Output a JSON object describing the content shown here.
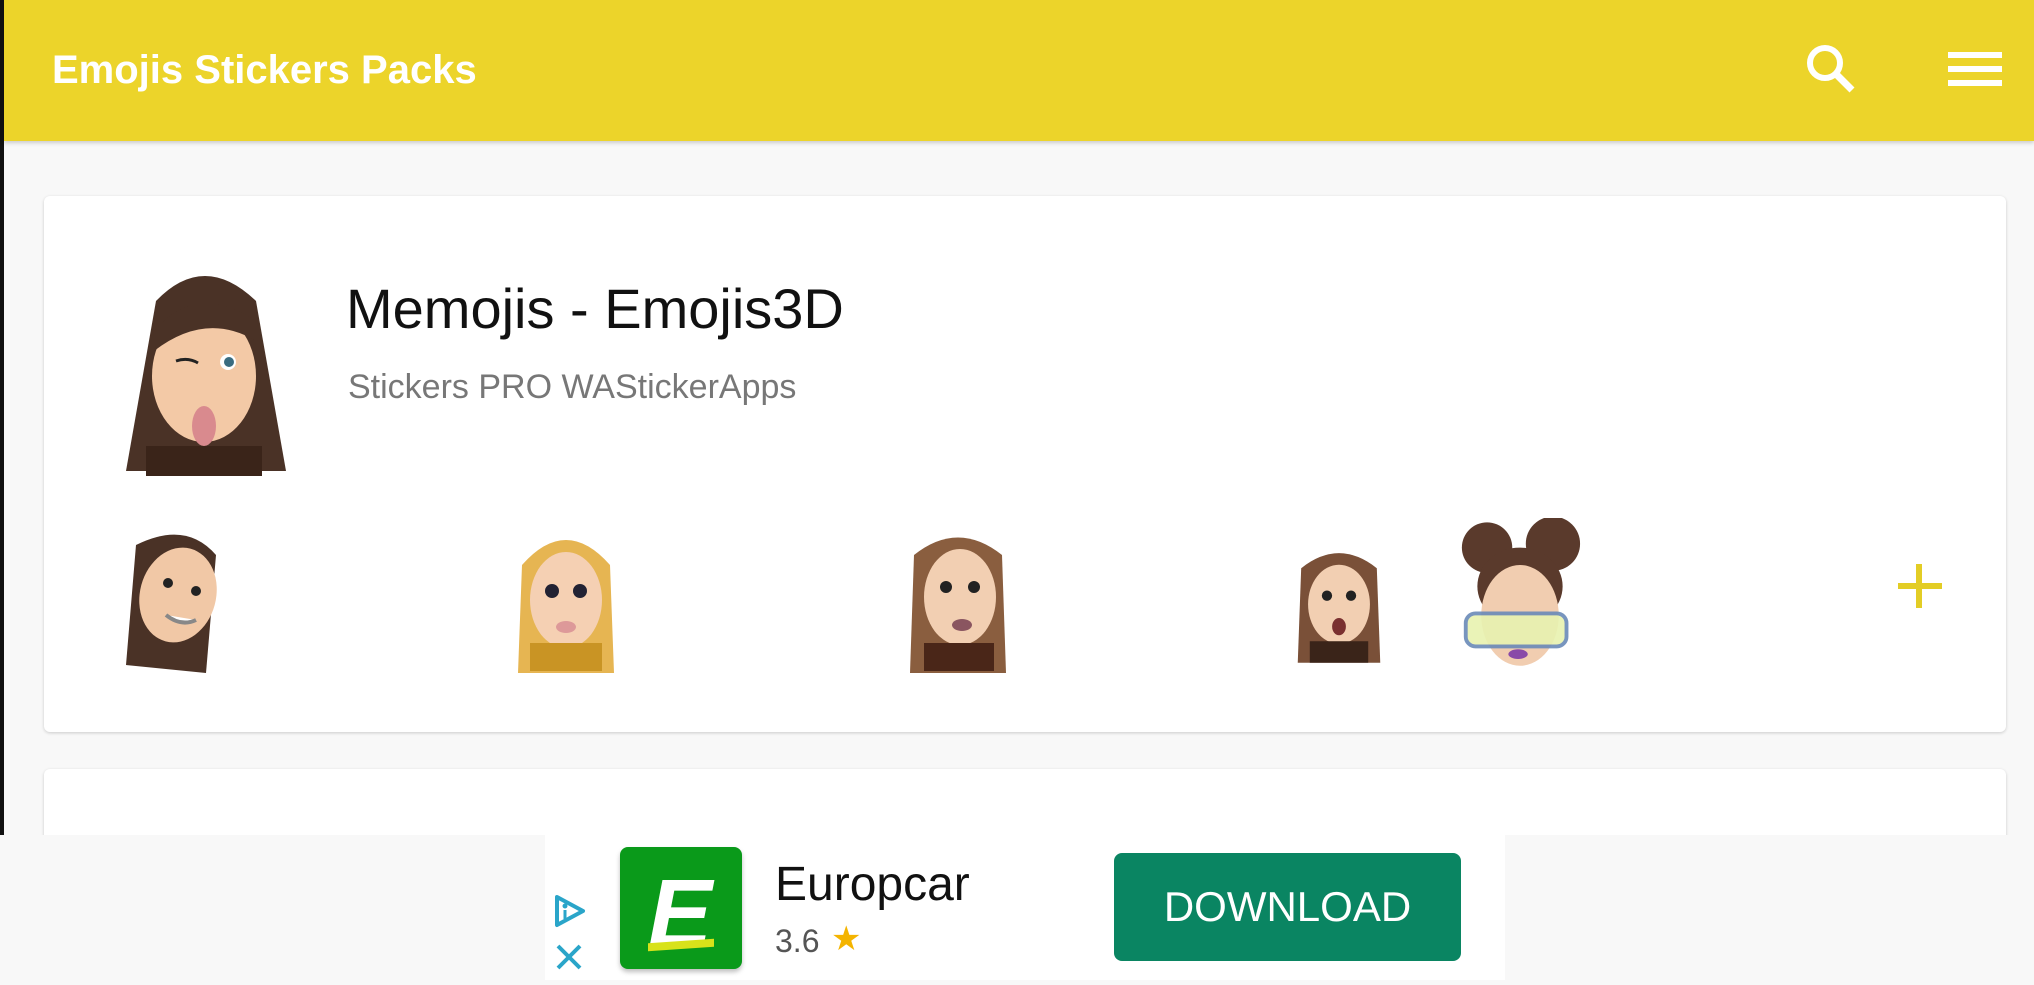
{
  "app": {
    "title": "Emojis Stickers Packs",
    "accent_color": "#ecd42a",
    "actions": [
      {
        "name": "search",
        "icon": "search-icon"
      },
      {
        "name": "menu",
        "icon": "hamburger-menu-icon"
      }
    ]
  },
  "packs": [
    {
      "title": "Memojis - Emojis3D",
      "author": "Stickers PRO WAStickerApps",
      "tray_icon": "memoji-winking-tongue",
      "preview_stickers": [
        "memoji-dark-hair-smiling",
        "memoji-blonde-hair",
        "memoji-brown-hair-hoops",
        "memoji-surprised",
        "memoji-space-buns-goggles"
      ],
      "add_icon": "plus-icon"
    }
  ],
  "ad": {
    "app_name": "Europcar",
    "rating": "3.6",
    "star_icon": "star-icon",
    "cta_label": "DOWNLOAD",
    "icon_letter": "E",
    "icon_color": "#0a9a1a",
    "cta_color": "#0a8562",
    "adchoices_icon": "adchoices-icon",
    "close_icon": "close-icon"
  }
}
